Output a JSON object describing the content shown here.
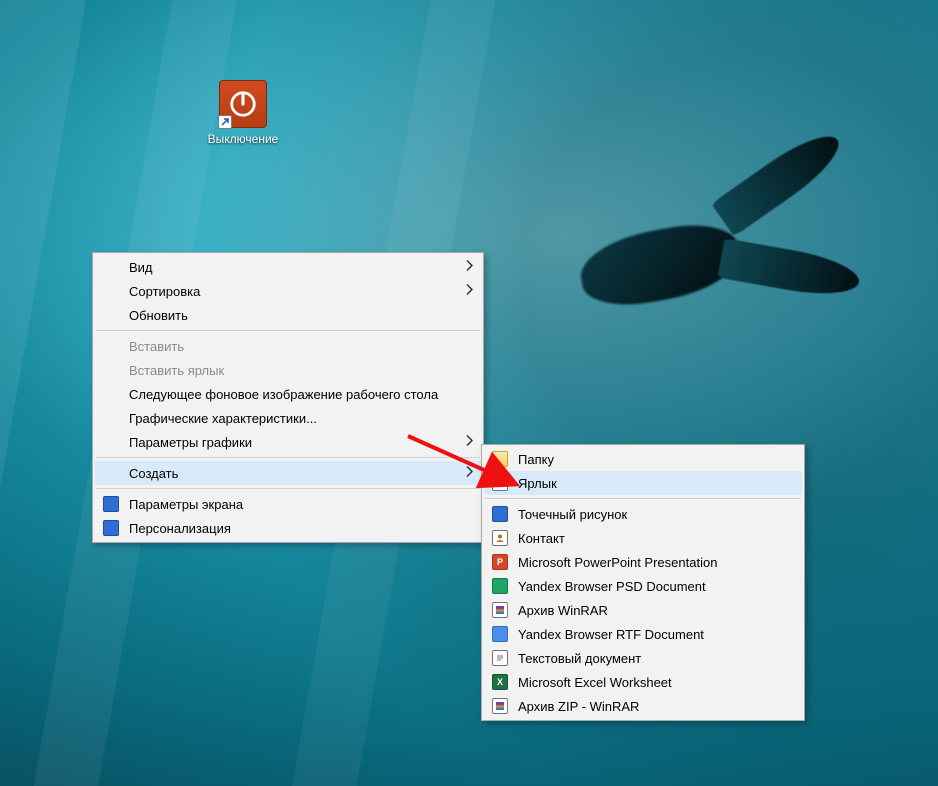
{
  "desktop": {
    "icon_label": "Выключение"
  },
  "context_menu": {
    "items": [
      {
        "label": "Вид",
        "submenu": true
      },
      {
        "label": "Сортировка",
        "submenu": true
      },
      {
        "label": "Обновить"
      }
    ],
    "items2": [
      {
        "label": "Вставить",
        "disabled": true
      },
      {
        "label": "Вставить ярлык",
        "disabled": true
      },
      {
        "label": "Следующее фоновое изображение рабочего стола"
      },
      {
        "label": "Графические характеристики..."
      },
      {
        "label": "Параметры графики",
        "submenu": true
      }
    ],
    "items3": [
      {
        "label": "Создать",
        "submenu": true,
        "highlight": true
      }
    ],
    "items4": [
      {
        "label": "Параметры экрана",
        "icon": "display"
      },
      {
        "label": "Персонализация",
        "icon": "pers"
      }
    ]
  },
  "submenu_new": {
    "items_top": [
      {
        "label": "Папку",
        "icon": "folder"
      },
      {
        "label": "Ярлык",
        "icon": "shortcut",
        "highlight": true
      }
    ],
    "items_bottom": [
      {
        "label": "Точечный рисунок",
        "icon": "bmp"
      },
      {
        "label": "Контакт",
        "icon": "contact"
      },
      {
        "label": "Microsoft PowerPoint Presentation",
        "icon": "ppt"
      },
      {
        "label": "Yandex Browser PSD Document",
        "icon": "psd"
      },
      {
        "label": "Архив WinRAR",
        "icon": "rar"
      },
      {
        "label": "Yandex Browser RTF Document",
        "icon": "rtf"
      },
      {
        "label": "Текстовый документ",
        "icon": "txt"
      },
      {
        "label": "Microsoft Excel Worksheet",
        "icon": "xls"
      },
      {
        "label": "Архив ZIP - WinRAR",
        "icon": "zip"
      }
    ]
  }
}
